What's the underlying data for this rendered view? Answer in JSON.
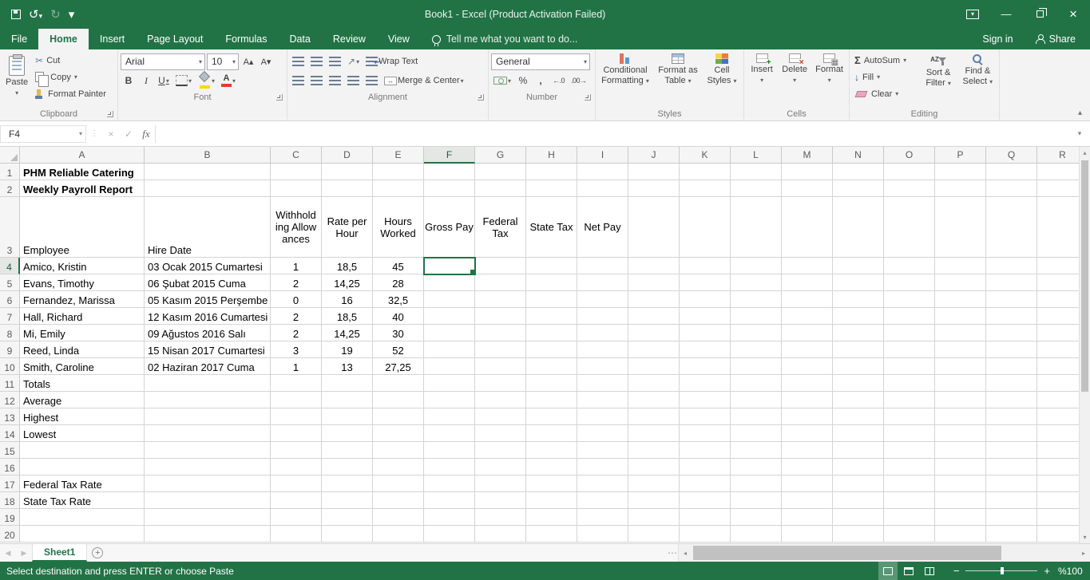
{
  "icons": {
    "caret": "▾",
    "collapse_chevron": "▴",
    "expand_chevron": "▾",
    "scissors": "✂",
    "undo": "↺",
    "redo": "↻",
    "minimize": "—",
    "close": "×",
    "ribbon_options_chevron": "▾",
    "cancel": "×",
    "enter": "✓",
    "sigma": "Σ",
    "percent": "%",
    "comma": ",",
    "increase_decimal": "←.0",
    "decrease_decimal": ".00→",
    "grow_font": "A▴",
    "shrink_font": "A▾",
    "orientation_arrow": "↗",
    "merge_arrows": "↔",
    "wrap_arrow": "↩",
    "fill_arrow": "↓",
    "sort_letters": "AZ",
    "nav_left": "◀",
    "nav_right": "▶",
    "scroll_left": "◂",
    "scroll_right": "▸",
    "scroll_up": "▴",
    "scroll_down": "▾",
    "plus": "+",
    "tab_splitter": "⋯",
    "formula_splitter": "⋮"
  },
  "title_bar": {
    "title": "Book1 - Excel (Product Activation Failed)"
  },
  "ribbon_tabs": [
    "File",
    "Home",
    "Insert",
    "Page Layout",
    "Formulas",
    "Data",
    "Review",
    "View"
  ],
  "tell_me": "Tell me what you want to do...",
  "account": {
    "sign_in": "Sign in",
    "share": "Share"
  },
  "ribbon": {
    "clipboard": {
      "label": "Clipboard",
      "paste": "Paste",
      "cut": "Cut",
      "copy": "Copy",
      "format_painter": "Format Painter"
    },
    "font": {
      "label": "Font",
      "name": "Arial",
      "size": "10",
      "bold": "B",
      "italic": "I",
      "underline": "U",
      "color_letter": "A"
    },
    "alignment": {
      "label": "Alignment",
      "wrap_text": "Wrap Text",
      "merge_center": "Merge & Center"
    },
    "number": {
      "label": "Number",
      "format": "General"
    },
    "styles": {
      "label": "Styles",
      "conditional_formatting": "Conditional Formatting",
      "format_as_table": "Format as Table",
      "cell_styles": "Cell Styles"
    },
    "cells": {
      "label": "Cells",
      "insert": "Insert",
      "delete": "Delete",
      "format": "Format"
    },
    "editing": {
      "label": "Editing",
      "autosum": "AutoSum",
      "fill": "Fill",
      "clear": "Clear",
      "sort_filter": "Sort & Filter",
      "find_select": "Find & Select"
    }
  },
  "formula_bar": {
    "name_box": "F4",
    "fx_label": "fx",
    "formula": ""
  },
  "sheet": {
    "columns": [
      "A",
      "B",
      "C",
      "D",
      "E",
      "F",
      "G",
      "H",
      "I",
      "J",
      "K",
      "L",
      "M",
      "N",
      "O",
      "P",
      "Q",
      "R"
    ],
    "row_count": 20,
    "default_col_width": 64,
    "col_widths": {
      "A": 156,
      "B": 158
    },
    "default_row_height": 21,
    "row_heights": {
      "3": 76
    },
    "selection": "F4",
    "cells": {
      "A1": {
        "text": "PHM Reliable Catering",
        "bold": true
      },
      "A2": {
        "text": "Weekly Payroll Report",
        "bold": true
      },
      "A3": {
        "text": "Employee"
      },
      "B3": {
        "text": "Hire Date"
      },
      "C3": {
        "text": "Withholding Allowances",
        "align": "center",
        "valign": "middle",
        "wrap": "break"
      },
      "D3": {
        "text": "Rate per Hour",
        "align": "center",
        "valign": "middle",
        "wrap": "word"
      },
      "E3": {
        "text": "Hours Worked",
        "align": "center",
        "valign": "middle",
        "wrap": "word"
      },
      "F3": {
        "text": "Gross Pay",
        "align": "center",
        "valign": "middle"
      },
      "G3": {
        "text": "Federal Tax",
        "align": "center",
        "valign": "middle",
        "wrap": "word"
      },
      "H3": {
        "text": "State Tax",
        "align": "center",
        "valign": "middle"
      },
      "I3": {
        "text": "Net Pay",
        "align": "center",
        "valign": "middle"
      },
      "A4": {
        "text": "Amico, Kristin"
      },
      "B4": {
        "text": "03 Ocak 2015 Cumartesi"
      },
      "C4": {
        "text": "1",
        "align": "center"
      },
      "D4": {
        "text": "18,5",
        "align": "center"
      },
      "E4": {
        "text": "45",
        "align": "center"
      },
      "A5": {
        "text": "Evans, Timothy"
      },
      "B5": {
        "text": "06 Şubat 2015 Cuma"
      },
      "C5": {
        "text": "2",
        "align": "center"
      },
      "D5": {
        "text": "14,25",
        "align": "center"
      },
      "E5": {
        "text": "28",
        "align": "center"
      },
      "A6": {
        "text": "Fernandez, Marissa"
      },
      "B6": {
        "text": "05 Kasım 2015 Perşembe"
      },
      "C6": {
        "text": "0",
        "align": "center"
      },
      "D6": {
        "text": "16",
        "align": "center"
      },
      "E6": {
        "text": "32,5",
        "align": "center"
      },
      "A7": {
        "text": "Hall, Richard"
      },
      "B7": {
        "text": "12 Kasım 2016 Cumartesi"
      },
      "C7": {
        "text": "2",
        "align": "center"
      },
      "D7": {
        "text": "18,5",
        "align": "center"
      },
      "E7": {
        "text": "40",
        "align": "center"
      },
      "A8": {
        "text": "Mi, Emily"
      },
      "B8": {
        "text": "09 Ağustos 2016 Salı"
      },
      "C8": {
        "text": "2",
        "align": "center"
      },
      "D8": {
        "text": "14,25",
        "align": "center"
      },
      "E8": {
        "text": "30",
        "align": "center"
      },
      "A9": {
        "text": "Reed, Linda"
      },
      "B9": {
        "text": "15 Nisan 2017 Cumartesi"
      },
      "C9": {
        "text": "3",
        "align": "center"
      },
      "D9": {
        "text": "19",
        "align": "center"
      },
      "E9": {
        "text": "52",
        "align": "center"
      },
      "A10": {
        "text": "Smith, Caroline"
      },
      "B10": {
        "text": "02 Haziran 2017 Cuma"
      },
      "C10": {
        "text": "1",
        "align": "center"
      },
      "D10": {
        "text": "13",
        "align": "center"
      },
      "E10": {
        "text": "27,25",
        "align": "center"
      },
      "A11": {
        "text": "Totals"
      },
      "A12": {
        "text": "Average"
      },
      "A13": {
        "text": "Highest"
      },
      "A14": {
        "text": "Lowest"
      },
      "A17": {
        "text": "Federal Tax Rate"
      },
      "A18": {
        "text": "State Tax Rate"
      }
    }
  },
  "sheet_tabs": {
    "active_tab": "Sheet1"
  },
  "status_bar": {
    "message": "Select destination and press ENTER or choose Paste",
    "zoom": "%100"
  },
  "colors": {
    "excel_green": "#217346",
    "grid_line": "#d4d4d4",
    "ribbon_bg": "#f3f3f3"
  }
}
